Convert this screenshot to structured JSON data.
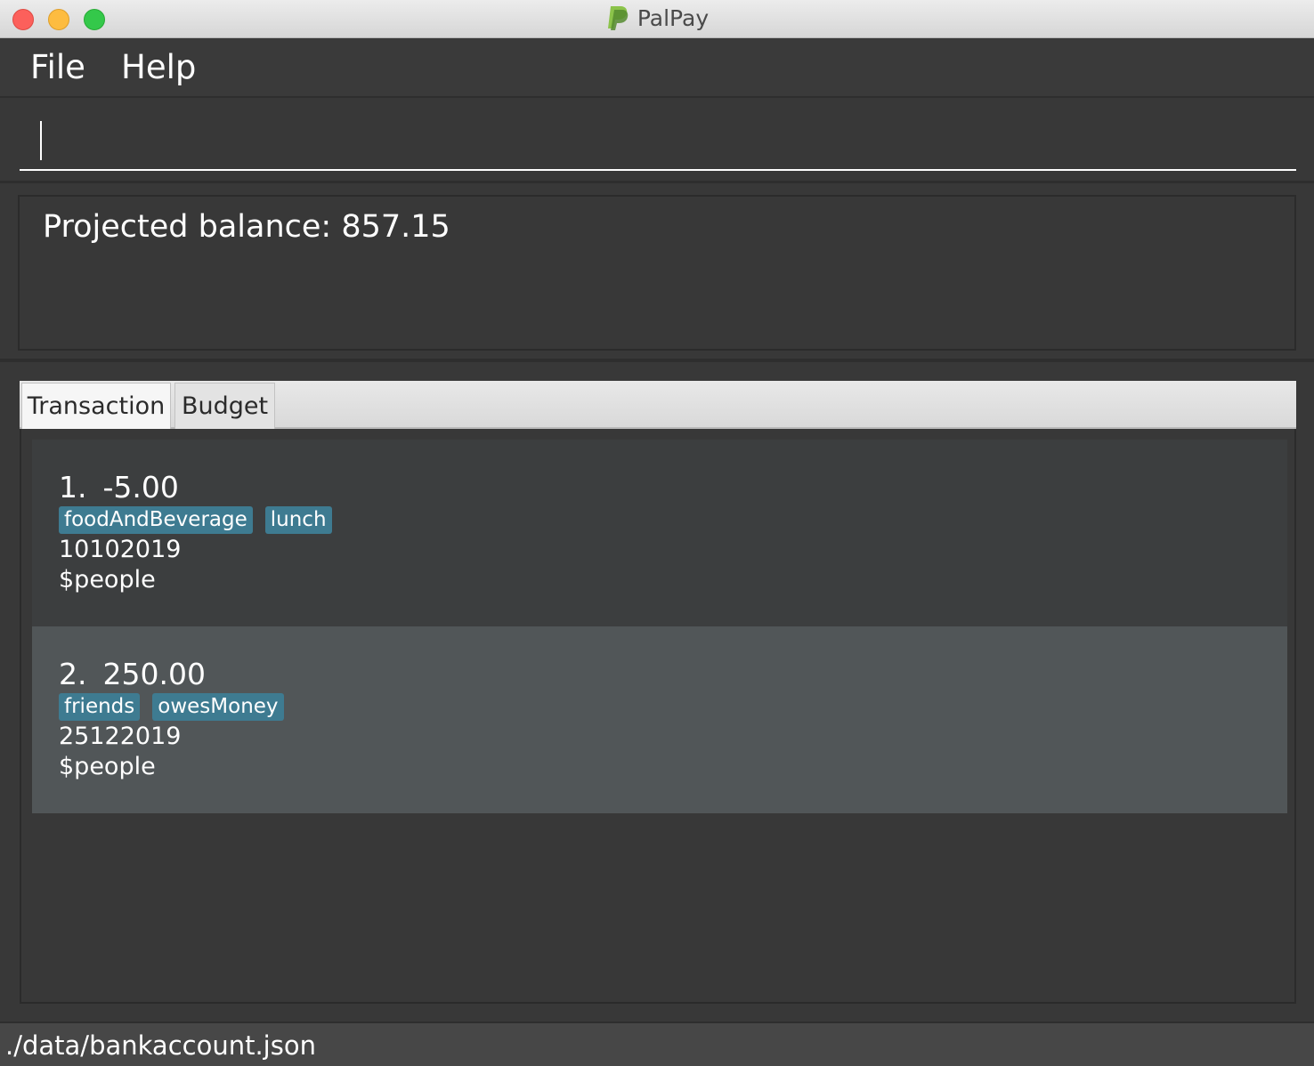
{
  "window": {
    "title": "PalPay",
    "logo_icon": "paypal-p-logo-icon",
    "controls": [
      "close",
      "minimize",
      "maximize"
    ]
  },
  "menu": {
    "file": "File",
    "help": "Help"
  },
  "command": {
    "value": ""
  },
  "result": {
    "text": "Projected balance: 857.15"
  },
  "tabs": [
    {
      "label": "Transaction",
      "selected": true
    },
    {
      "label": "Budget",
      "selected": false
    }
  ],
  "transactions": [
    {
      "index": "1.",
      "amount": "-5.00",
      "tags": [
        "foodAndBeverage",
        "lunch"
      ],
      "date": "10102019",
      "people": "$people"
    },
    {
      "index": "2.",
      "amount": "250.00",
      "tags": [
        "friends",
        "owesMoney"
      ],
      "date": "25122019",
      "people": "$people"
    }
  ],
  "status": {
    "path": "./data/bankaccount.json"
  },
  "colors": {
    "background": "#383838",
    "tag": "#3e7b91",
    "selected_row": "#515658",
    "logo_green": "#7cb342"
  }
}
